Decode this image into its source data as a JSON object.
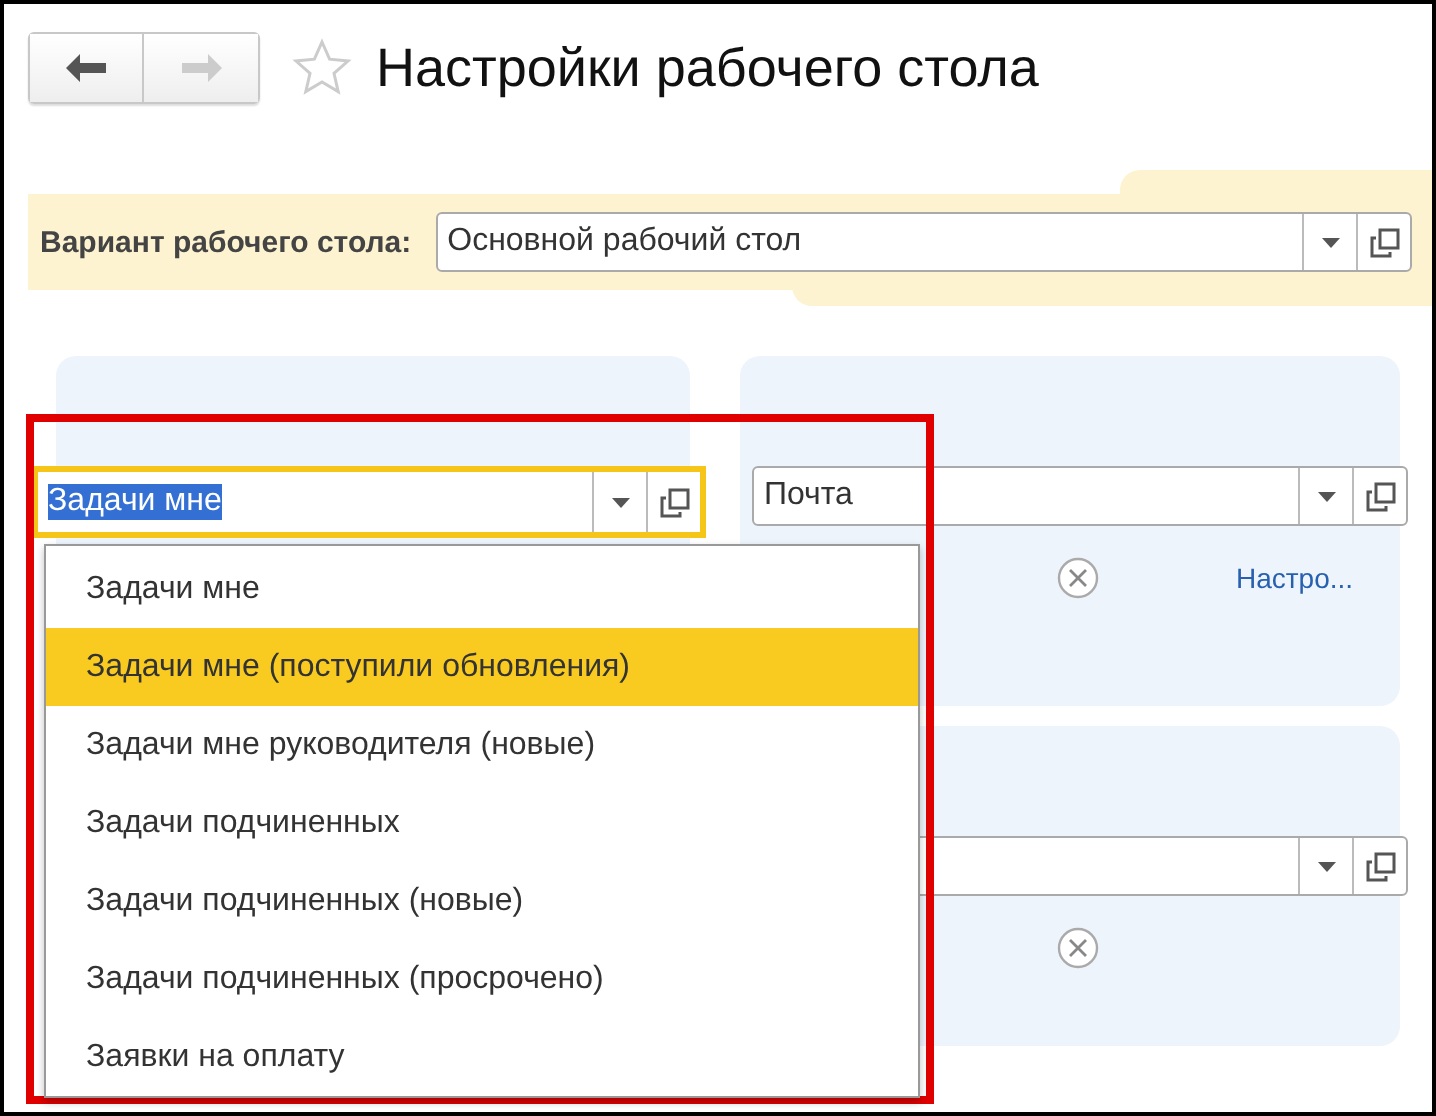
{
  "header": {
    "back_disabled": false,
    "forward_disabled": true,
    "favorite": false,
    "title": "Настройки рабочего стола"
  },
  "variant": {
    "label": "Вариант рабочего стола:",
    "value": "Основной рабочий стол"
  },
  "tasks_field": {
    "value": "Задачи мне",
    "focused": true
  },
  "mail_panel": {
    "value": "Почта",
    "link": "Настро..."
  },
  "dropdown": {
    "items": [
      {
        "label": "Задачи мне",
        "selected": false
      },
      {
        "label": "Задачи мне (поступили обновления)",
        "selected": true
      },
      {
        "label": "Задачи мне руководителя (новые)",
        "selected": false
      },
      {
        "label": "Задачи подчиненных",
        "selected": false
      },
      {
        "label": "Задачи подчиненных (новые)",
        "selected": false
      },
      {
        "label": "Задачи подчиненных (просрочено)",
        "selected": false
      },
      {
        "label": "Заявки на оплату",
        "selected": false
      }
    ]
  }
}
